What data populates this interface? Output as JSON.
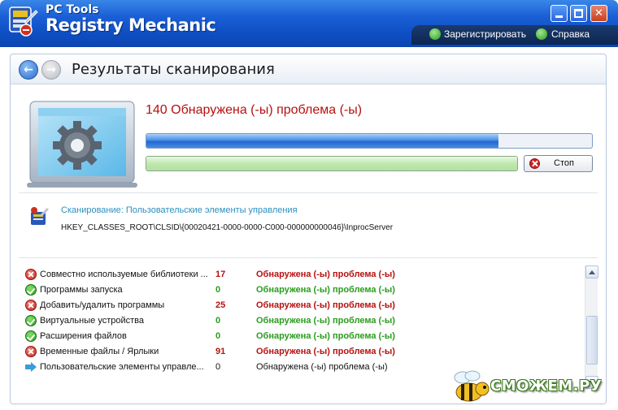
{
  "window": {
    "brand": "PC Tools",
    "title": "Registry Mechanic"
  },
  "topmenu": {
    "register_label": "Зарегистрировать",
    "help_label": "Справка"
  },
  "header": {
    "title": "Результаты сканирования"
  },
  "scan": {
    "issue_count_text": "140  Обнаружена (-ы) проблема (-ы)",
    "progress_fraction": 0.79,
    "stop_label": "Стоп",
    "current_label": "Сканирование: Пользовательские элементы управления",
    "current_path": "HKEY_CLASSES_ROOT\\CLSID\\{00020421-0000-0000-C000-000000000046}\\InprocServer"
  },
  "results": [
    {
      "status": "error",
      "name": "Совместно используемые библиотеки ...",
      "count": "17",
      "message": "Обнаружена (-ы) проблема (-ы)"
    },
    {
      "status": "ok",
      "name": "Программы запуска",
      "count": "0",
      "message": "Обнаружена (-ы) проблема (-ы)"
    },
    {
      "status": "error",
      "name": "Добавить/удалить программы",
      "count": "25",
      "message": "Обнаружена (-ы) проблема (-ы)"
    },
    {
      "status": "ok",
      "name": "Виртуальные устройства",
      "count": "0",
      "message": "Обнаружена (-ы) проблема (-ы)"
    },
    {
      "status": "ok",
      "name": "Расширения файлов",
      "count": "0",
      "message": "Обнаружена (-ы) проблема (-ы)"
    },
    {
      "status": "error",
      "name": "Временные файлы / Ярлыки",
      "count": "91",
      "message": "Обнаружена (-ы) проблема (-ы)"
    },
    {
      "status": "in-progress",
      "name": "Пользовательские элементы управле...",
      "count": "0",
      "message": "Обнаружена (-ы) проблема (-ы)"
    }
  ],
  "watermark": {
    "text": "СМОЖЕМ.РУ"
  },
  "colors": {
    "titlebar": "#1a5fd6",
    "error": "#b81010",
    "ok": "#2a9c1c",
    "scan_label": "#2b8fbf"
  }
}
